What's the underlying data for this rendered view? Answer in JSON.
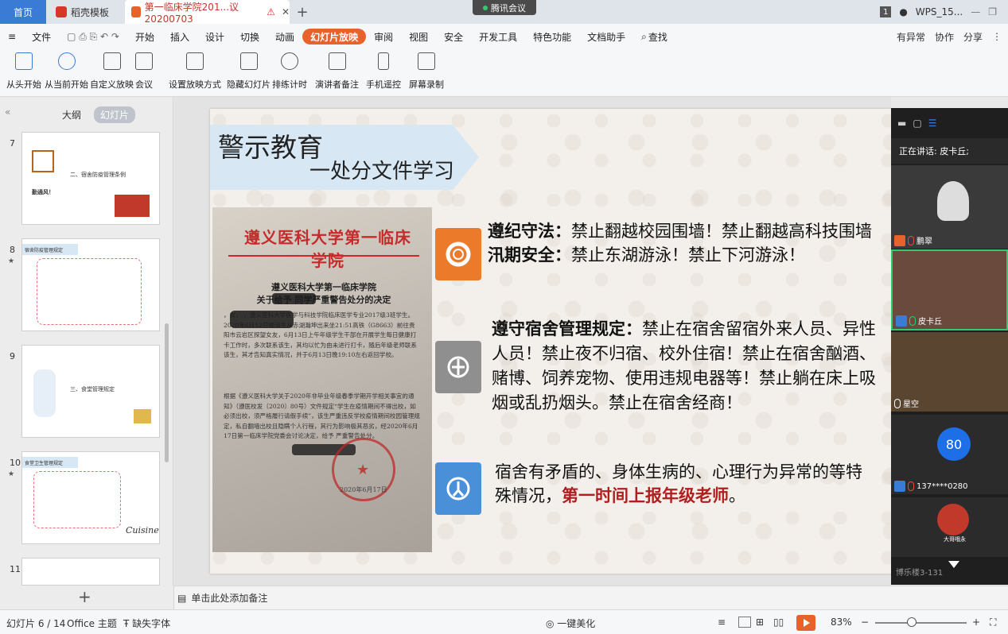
{
  "tabs": {
    "home": "首页",
    "template": "稻壳模板",
    "doc": "第一临床学院201...议20200703",
    "meeting": "腾讯会议",
    "user": "WPS_15..."
  },
  "menu": {
    "file": "文件",
    "items": [
      "开始",
      "插入",
      "设计",
      "切换",
      "动画",
      "幻灯片放映",
      "审阅",
      "视图",
      "安全",
      "开发工具",
      "特色功能",
      "文档助手"
    ],
    "search": "查找",
    "right": [
      "有异常",
      "协作",
      "分享"
    ]
  },
  "ribbon": [
    "从头开始",
    "从当前开始",
    "自定义放映",
    "会议",
    "设置放映方式",
    "隐藏幻灯片",
    "排练计时",
    "演讲者备注",
    "手机遥控",
    "屏幕录制"
  ],
  "leftpanel": {
    "tab_outline": "大纲",
    "tab_slides": "幻灯片",
    "thumbs": [
      {
        "num": "7",
        "caption": "二、宿舍防疫管理条例",
        "sub": "勤通风！"
      },
      {
        "num": "8",
        "caption": "宿舍防疫管理规定"
      },
      {
        "num": "9",
        "caption": "三、食堂管理规定"
      },
      {
        "num": "10",
        "caption": "食堂卫生管理规定"
      },
      {
        "num": "11",
        "caption": ""
      }
    ]
  },
  "slide": {
    "title_main": "警示教育",
    "title_sub": "一处分文件学习",
    "doc_head": "遵义医科大学第一临床学院",
    "doc_title1": "遵义医科大学第一临床学院",
    "doc_title2": "关于给予       同学严重警告处分的决定",
    "doc_para1": "       ，女，     ，遵义医科大学医学与科技学院临床医学专业2017级3班学生。2020年6月12日晚该生从赤湖瀚坤出来坐21:51高铁（G8663）前往贵阳市云岩区探望女友，6月13日上午年级学生干部在开展学生每日健康打卡工作时，多次联系该生，其均以忙为由未进行打卡，随后年级老师联系该生，其才告知真实情况，并于6月13日晚19:10左右返回学校。",
    "doc_para2": "根据《遵义医科大学关于2020年非毕业年级春季学期开学相关事宜的通知》（遵医校发〔2020〕80号）文件规定“学生在疫情期间不得出校，如必须出校，须严格履行请假手续”，该生严重违反学校疫情期间校园管理规定，私自翻墙出校且隐瞒个人行程，其行为影响极其恶劣，经2020年6月17日第一临床学院党委会讨论决定，给予      严重警告处分。",
    "doc_date": "2020年6月17日",
    "rule1_label": "遵纪守法：",
    "rule1_text": "禁止翻越校园围墙！禁止翻越高科技围墙",
    "rule2_label": "汛期安全：",
    "rule2_text": "禁止东湖游泳！禁止下河游泳！",
    "rule3_label": "遵守宿舍管理规定：",
    "rule3_text": "禁止在宿舍留宿外来人员、异性人员！禁止夜不归宿、校外住宿！禁止在宿舍酗酒、赌博、饲养宠物、使用违规电器等！禁止躺在床上吸烟或乱扔烟头。禁止在宿舍经商！",
    "rule4_text": "宿舍有矛盾的、身体生病的、心理行为异常的等特殊情况，",
    "rule4_red": "第一时间上报年级老师",
    "rule4_end": "。"
  },
  "video": {
    "speaking": "正在讲话: 皮卡丘;",
    "participants": [
      {
        "name": "鹏翠"
      },
      {
        "name": "皮卡丘"
      },
      {
        "name": "星空"
      },
      {
        "name": "137****0280",
        "avatar": "80"
      },
      {
        "name": "大哥哦永"
      }
    ],
    "bottom": "博乐楼3-131"
  },
  "notes": "单击此处添加备注",
  "status": {
    "slide": "幻灯片 6 / 14",
    "theme": "Office 主题",
    "font": "缺失字体",
    "beautify": "一键美化",
    "zoom": "83%"
  },
  "colors": {
    "accent": "#e8622c",
    "home_tab": "#3a7bd5",
    "icon_orange": "#ec7a2b",
    "icon_gray": "#8f8f8f",
    "icon_blue": "#4a90d9"
  }
}
